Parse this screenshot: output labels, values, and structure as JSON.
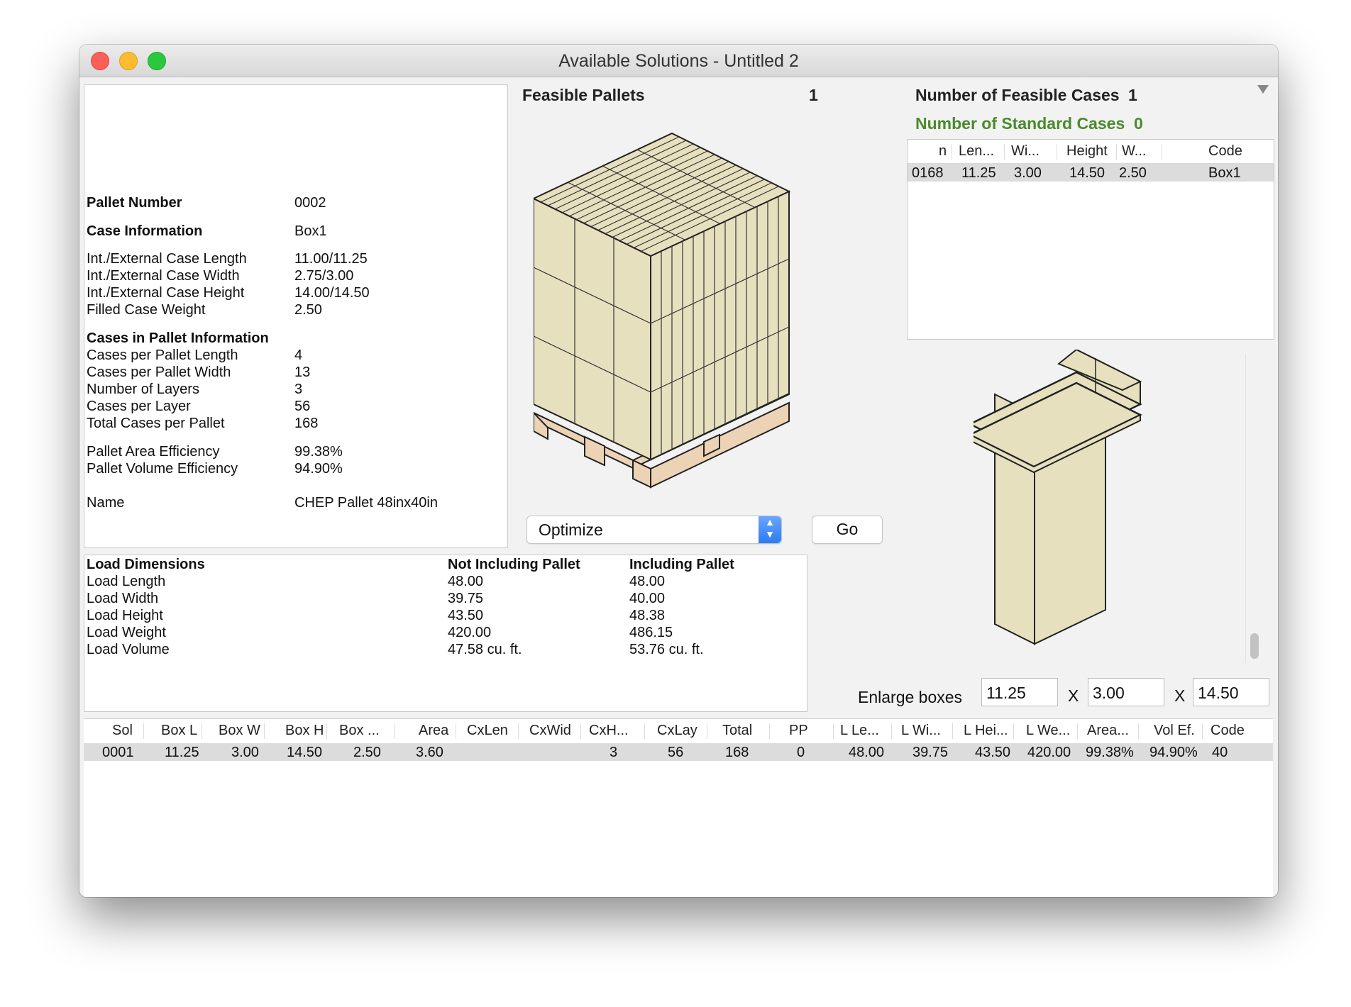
{
  "window": {
    "title": "Available Solutions - Untitled 2"
  },
  "info": {
    "pallet_number_label": "Pallet Number",
    "pallet_number": "0002",
    "case_info_label": "Case Information",
    "case_info": "Box1",
    "case_length_label": "Int./External Case Length",
    "case_length": "11.00/11.25",
    "case_width_label": "Int./External Case Width",
    "case_width": "2.75/3.00",
    "case_height_label": "Int./External Case Height",
    "case_height": "14.00/14.50",
    "case_weight_label": "Filled Case Weight",
    "case_weight": "2.50",
    "cases_in_pallet_label": "Cases in Pallet Information",
    "per_length_label": "Cases per Pallet Length",
    "per_length": "4",
    "per_width_label": "Cases per Pallet Width",
    "per_width": "13",
    "layers_label": "Number of Layers",
    "layers": "3",
    "per_layer_label": "Cases per Layer",
    "per_layer": "56",
    "total_label": "Total Cases per Pallet",
    "total": "168",
    "area_eff_label": "Pallet Area Efficiency",
    "area_eff": "99.38%",
    "vol_eff_label": "Pallet Volume Efficiency",
    "vol_eff": "94.90%",
    "name_label": "Name",
    "name": "CHEP Pallet 48inx40in"
  },
  "load": {
    "headers": [
      "Load Dimensions",
      "Not Including Pallet",
      "Including Pallet"
    ],
    "rows": [
      [
        "Load Length",
        "48.00",
        "48.00"
      ],
      [
        "Load Width",
        "39.75",
        "40.00"
      ],
      [
        "Load Height",
        "43.50",
        "48.38"
      ],
      [
        "Load Weight",
        "420.00",
        "486.15"
      ],
      [
        "Load Volume",
        "47.58 cu. ft.",
        "53.76 cu. ft."
      ]
    ]
  },
  "feasible": {
    "pallets_label": "Feasible Pallets",
    "pallets_count": "1",
    "cases_label": "Number of Feasible Cases",
    "cases_count": "1",
    "standard_label": "Number of Standard Cases",
    "standard_count": "0"
  },
  "controls": {
    "optimize_label": "Optimize",
    "go_label": "Go"
  },
  "cases_table": {
    "headers": [
      "n",
      "Len...",
      "Wi...",
      "Height",
      "W...",
      "Code"
    ],
    "rows": [
      [
        "0168",
        "11.25",
        "3.00",
        "14.50",
        "2.50",
        "Box1"
      ]
    ]
  },
  "enlarge": {
    "label": "Enlarge boxes",
    "x": "X",
    "l": "11.25",
    "w": "3.00",
    "h": "14.50"
  },
  "solutions_table": {
    "headers": [
      "Sol",
      "Box L",
      "Box W",
      "Box H",
      "Box ...",
      "Area",
      "CxLen",
      "CxWid",
      "CxH...",
      "CxLay",
      "Total",
      "PP",
      "L Le...",
      "L Wi...",
      "L Hei...",
      "L We...",
      "Area...",
      "Vol Ef.",
      "Code"
    ],
    "rows": [
      [
        "0001",
        "11.25",
        "3.00",
        "14.50",
        "2.50",
        "3.60",
        "",
        "",
        "3",
        "56",
        "168",
        "0",
        "48.00",
        "39.75",
        "43.50",
        "420.00",
        "99.38%",
        "94.90%",
        "40"
      ]
    ]
  },
  "colors": {
    "box_fill": "#e6e0bf",
    "pallet_wood": "#ecd3b5",
    "standard_green": "#4a8b2c",
    "selected_row": "#dcdcdc"
  },
  "icons": [
    "close-icon",
    "minimize-icon",
    "zoom-icon",
    "popup-chevron-icon",
    "disclosure-triangle-icon"
  ]
}
